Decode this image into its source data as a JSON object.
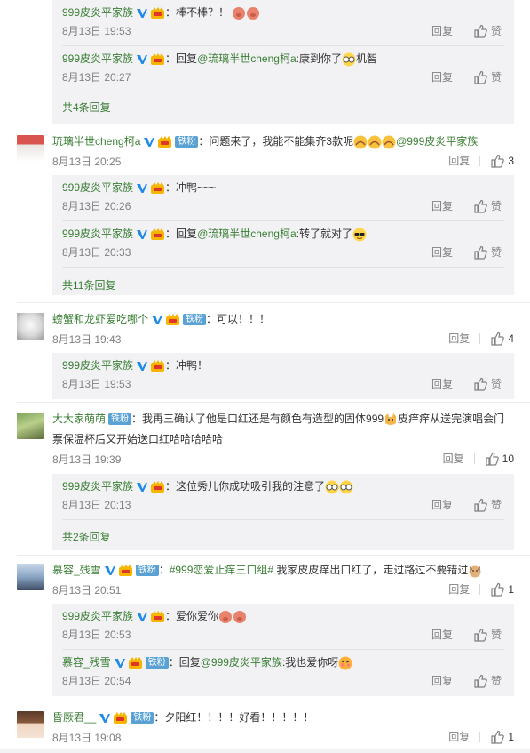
{
  "labels": {
    "reply": "回复",
    "like": "赞",
    "fan_badge": "铁粉"
  },
  "top_thread": {
    "replies": [
      {
        "name": "999皮炎平家族",
        "sep": "：",
        "text": "棒不棒？！",
        "time": "8月13日 19:53"
      },
      {
        "name": "999皮炎平家族",
        "sep": "：",
        "reply_word": "回复",
        "mention": "@琉璃半世cheng柯a",
        "text": ":康到你了",
        "text2": "机智",
        "time": "8月13日 20:27"
      }
    ],
    "more": "共4条回复"
  },
  "comments": [
    {
      "name": "琉璃半世cheng柯a",
      "sep": "：",
      "text": "问题来了，我能不能集齐3款呢",
      "mention": "@999皮炎平家族",
      "time": "8月13日 20:25",
      "likes": "3",
      "replies": [
        {
          "name": "999皮炎平家族",
          "sep": "：",
          "text": "冲鸭~~~",
          "time": "8月13日 20:26"
        },
        {
          "name": "999皮炎平家族",
          "sep": "：",
          "reply_word": "回复",
          "mention": "@琉璃半世cheng柯a",
          "text": ":转了就对了",
          "time": "8月13日 20:33"
        }
      ],
      "more": "共11条回复"
    },
    {
      "name": "螃蟹和龙虾爱吃哪个",
      "sep": "：",
      "text": "可以！！！",
      "time": "8月13日 19:43",
      "likes": "4",
      "replies": [
        {
          "name": "999皮炎平家族",
          "sep": "：",
          "text": "冲鸭！",
          "time": "8月13日 19:53"
        }
      ]
    },
    {
      "name": "大大家萌萌",
      "sep": "：",
      "text": "我再三确认了他是口红还是有颜色有造型的固体999",
      "text_b": "皮痒痒从送完演唱会门",
      "text_line2": "票保温杯后又开始送口红哈哈哈哈哈",
      "time": "8月13日 19:39",
      "likes": "10",
      "replies": [
        {
          "name": "999皮炎平家族",
          "sep": "：",
          "text": "这位秀儿你成功吸引我的注意了",
          "time": "8月13日 20:13"
        }
      ],
      "more": "共2条回复"
    },
    {
      "name": "慕容_残雪",
      "sep": "：",
      "hashtag": "#999恋爱止痒三口组#",
      "text": " 我家皮皮痒出口红了，走过路过不要错过",
      "time": "8月13日 20:51",
      "likes": "1",
      "replies": [
        {
          "name": "999皮炎平家族",
          "sep": "：",
          "text": "爱你爱你",
          "time": "8月13日 20:53"
        },
        {
          "name": "慕容_残雪",
          "sep": "：",
          "reply_word": "回复",
          "mention": "@999皮炎平家族",
          "text": ":我也爱你呀",
          "time": "8月13日 20:54"
        }
      ]
    },
    {
      "name": "昏厥君__",
      "sep": "：",
      "text": "夕阳红！！！！好看！！！！！",
      "time": "8月13日 19:08",
      "likes": "1"
    }
  ],
  "icons": {
    "verified": "blue-v-icon",
    "level": "crown-level-icon",
    "thumb": "thumb-up-icon",
    "emojis": [
      "cheers-emoji",
      "glasses-emoji",
      "bow-emoji",
      "sunglasses-emoji",
      "cat-emoji",
      "pig-emoji",
      "dog-emoji",
      "shy-emoji"
    ]
  },
  "colors": {
    "name": "#eb7350",
    "link": "#3a7e34",
    "reply_bg": "#f2f2f5",
    "time": "#808080",
    "fan_badge": "#5aa2d4"
  }
}
